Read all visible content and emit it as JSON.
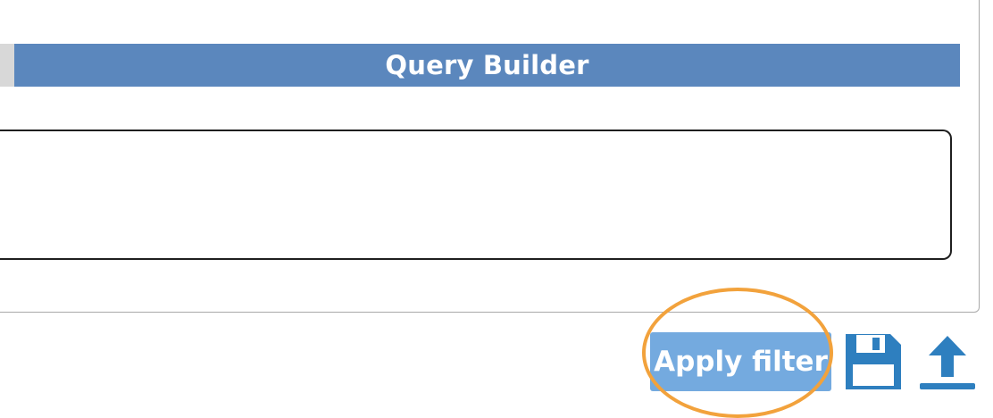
{
  "header": {
    "title": "Query Builder"
  },
  "query_editor": {
    "value": ""
  },
  "actions": {
    "apply_label": "Apply filter",
    "save_icon": "save-icon",
    "upload_icon": "upload-icon"
  },
  "colors": {
    "header_bg": "#5b87bd",
    "apply_bg": "#74aadf",
    "icon_color": "#2e7fbf",
    "highlight_ring": "#f2a23c"
  }
}
